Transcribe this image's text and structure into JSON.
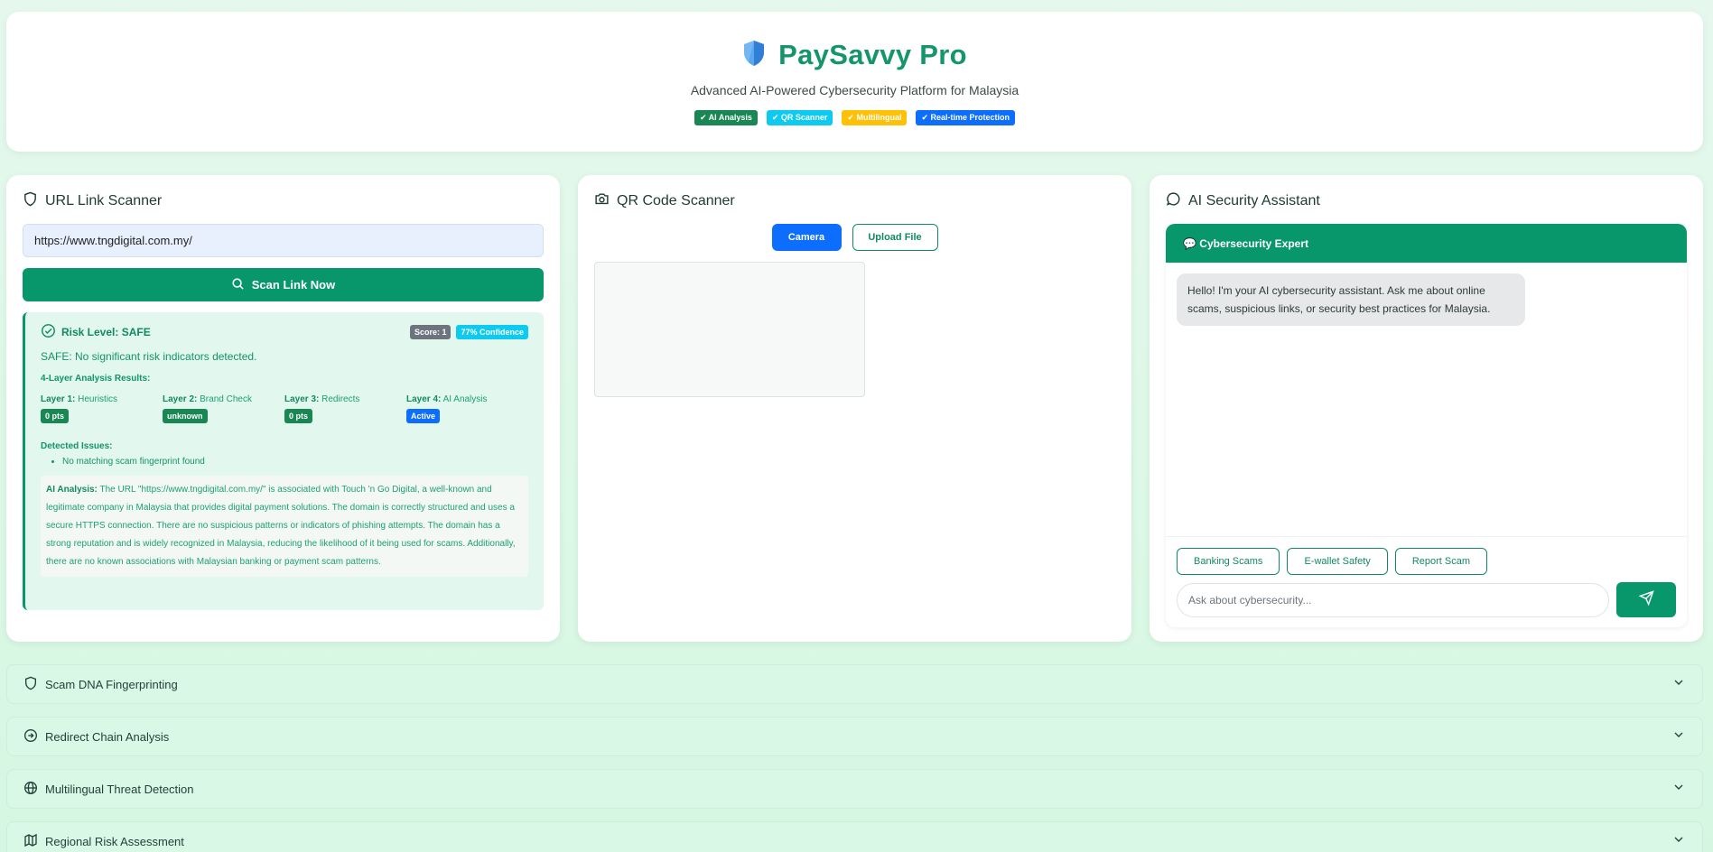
{
  "header": {
    "title": "PaySavvy Pro",
    "subtitle": "Advanced AI-Powered Cybersecurity Platform for Malaysia",
    "badges": [
      "✔ AI Analysis",
      "✔ QR Scanner",
      "✔ Multilingual",
      "✔ Real-time Protection"
    ]
  },
  "url_scanner": {
    "title": "URL Link Scanner",
    "input_value": "https://www.tngdigital.com.my/",
    "scan_label": "Scan Link Now",
    "result": {
      "risk_label": "Risk Level: SAFE",
      "score": "Score: 1",
      "confidence": "77% Confidence",
      "message": "SAFE: No significant risk indicators detected.",
      "layers_heading": "4-Layer Analysis Results:",
      "layers": [
        {
          "name": "Layer 1:",
          "desc": "Heuristics",
          "value": "0 pts",
          "color": "#198754"
        },
        {
          "name": "Layer 2:",
          "desc": "Brand Check",
          "value": "unknown",
          "color": "#198754"
        },
        {
          "name": "Layer 3:",
          "desc": "Redirects",
          "value": "0 pts",
          "color": "#198754"
        },
        {
          "name": "Layer 4:",
          "desc": "AI Analysis",
          "value": "Active",
          "color": "#0d6efd"
        }
      ],
      "issues_heading": "Detected Issues:",
      "issues": [
        "No matching scam fingerprint found"
      ],
      "ai_label": "AI Analysis:",
      "ai_text": "The URL \"https://www.tngdigital.com.my/\" is associated with Touch 'n Go Digital, a well-known and legitimate company in Malaysia that provides digital payment solutions. The domain is correctly structured and uses a secure HTTPS connection. There are no suspicious patterns or indicators of phishing attempts. The domain has a strong reputation and is widely recognized in Malaysia, reducing the likelihood of it being used for scams. Additionally, there are no known associations with Malaysian banking or payment scam patterns."
    }
  },
  "qr_scanner": {
    "title": "QR Code Scanner",
    "camera_label": "Camera",
    "upload_label": "Upload File"
  },
  "assistant": {
    "title": "AI Security Assistant",
    "chat_header": "💬 Cybersecurity Expert",
    "greeting": "Hello! I'm your AI cybersecurity assistant. Ask me about online scams, suspicious links, or security best practices for Malaysia.",
    "chips": [
      "Banking Scams",
      "E-wallet Safety",
      "Report Scam"
    ],
    "input_placeholder": "Ask about cybersecurity..."
  },
  "sections": [
    {
      "label": "Scam DNA Fingerprinting",
      "icon": "shield-icon"
    },
    {
      "label": "Redirect Chain Analysis",
      "icon": "arrow-circle-icon"
    },
    {
      "label": "Multilingual Threat Detection",
      "icon": "globe-icon"
    },
    {
      "label": "Regional Risk Assessment",
      "icon": "map-icon"
    }
  ],
  "colors": {
    "primary": "#08976b",
    "accent_blue": "#0d6efd",
    "brand": "#14956a"
  }
}
